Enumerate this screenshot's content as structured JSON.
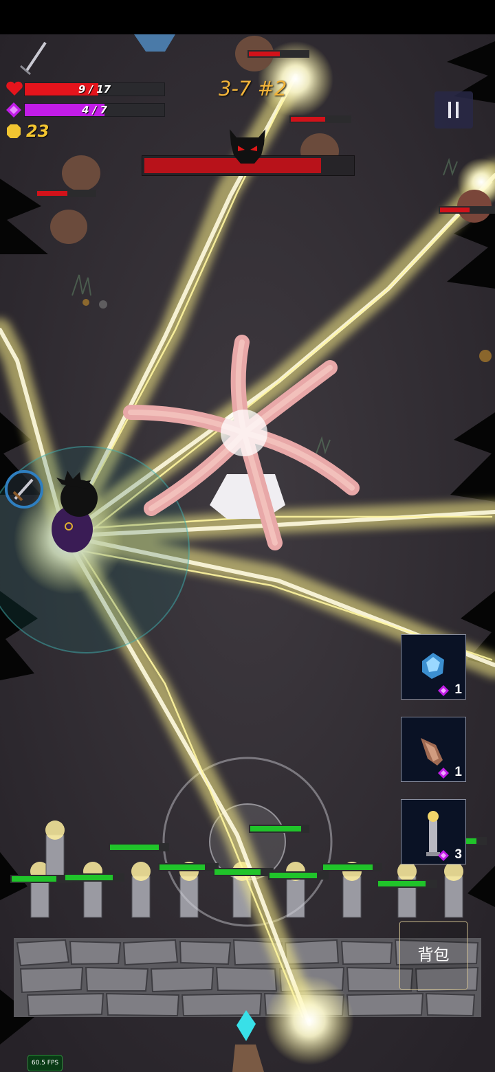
{
  "hud": {
    "hp_text": "9 / 17",
    "hp_fraction": 0.529,
    "mp_text": "4 / 7",
    "mp_fraction": 0.571,
    "coins": "23",
    "wave": "3-7 #2",
    "boss_hp_fraction": 0.85
  },
  "skills": [
    {
      "icon": "crystal-icon",
      "cost": "1"
    },
    {
      "icon": "shell-icon",
      "cost": "1"
    },
    {
      "icon": "torch-tower-icon",
      "cost": "3"
    }
  ],
  "bag_label": "背包",
  "fps": "60.5 FPS",
  "colors": {
    "hp": "#e5141c",
    "mana": "#c21ce8",
    "coin": "#f2c531",
    "wave": "#f2b43a",
    "lightning": "#fff38a",
    "tower_hp": "#20c42a",
    "enemy_hp": "#d2121a"
  },
  "enemy_hp_fractions": [
    0.5,
    0.55,
    0.5,
    0.53
  ],
  "tower_hp_fractions": [
    0.75,
    0.82,
    0.85,
    0.78,
    0.8,
    0.82,
    0.86,
    0.82,
    0.85,
    0.88
  ]
}
